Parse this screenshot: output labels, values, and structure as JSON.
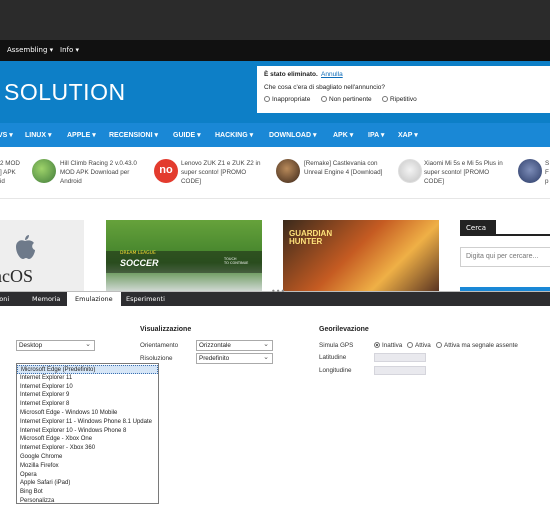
{
  "site_nav": {
    "items": [
      "Assembling ▾",
      "Info ▾"
    ]
  },
  "header": {
    "logo": "SOLUTION"
  },
  "notice": {
    "title": "È stato eliminato.",
    "undo": "Annulla",
    "question": "Che cosa c'era di sbagliato nell'annuncio?",
    "options": [
      "Inappropriate",
      "Non pertinente",
      "Ripetitivo"
    ]
  },
  "categories": [
    "VS ▾",
    "LINUX ▾",
    "APPLE ▾",
    "RECENSIONI ▾",
    "GUIDE ▾",
    "HACKING ▾",
    "DOWNLOAD ▾",
    "APK ▾",
    "IPA ▾",
    "XAP ▾"
  ],
  "ticker": [
    {
      "text": "2 MOD\n] APK\nid"
    },
    {
      "text": "Hill Climb Racing 2 v.0.43.0\nMOD APK Download per\nAndroid"
    },
    {
      "badge": "no",
      "text": "Lenovo ZUK Z1 e ZUK Z2 in\nsuper sconto! [PROMO\nCODE]"
    },
    {
      "text": "[Remake] Castlevania con\nUnreal Engine 4 [Download]"
    },
    {
      "text": "Xiaomi Mi 5s e Mi 5s Plus in\nsuper sconto! [PROMO\nCODE]"
    },
    {
      "text": "S\nF\np"
    }
  ],
  "featured": {
    "mac": "acOS",
    "soccer_brand": "DREAM LEAGUE",
    "soccer_title": "SOCCER",
    "soccer_cta": "TOUCH\nTO CONTINUE",
    "hunter_title": "GUARDIAN\nHUNTER"
  },
  "search": {
    "title": "Cerca",
    "placeholder": "Digita qui per cercare..."
  },
  "devtools": {
    "tabs": [
      "zioni",
      "Memoria",
      "Emulazione",
      "Esperimenti"
    ],
    "active_tab": "Emulazione",
    "mode": {
      "value": "Desktop"
    },
    "visualizzazione": {
      "section": "Visualizzazione",
      "orientamento_label": "Orientamento",
      "orientamento_value": "Orizzontale",
      "risoluzione_label": "Risoluzione",
      "risoluzione_value": "Predefinito"
    },
    "georilevazione": {
      "section": "Georilevazione",
      "gps_label": "Simula GPS",
      "gps_options": [
        "Inattiva",
        "Attiva",
        "Attiva ma segnale assente"
      ],
      "lat_label": "Latitudine",
      "lon_label": "Longitudine"
    },
    "user_agents": [
      "Microsoft Edge (Predefinito)",
      "Internet Explorer 11",
      "Internet Explorer 10",
      "Internet Explorer 9",
      "Internet Explorer 8",
      "Microsoft Edge - Windows 10 Mobile",
      "Internet Explorer 11 - Windows Phone 8.1 Update",
      "Internet Explorer 10 - Windows Phone 8",
      "Microsoft Edge - Xbox One",
      "Internet Explorer - Xbox 360",
      "Google Chrome",
      "Mozilla Firefox",
      "Opera",
      "Apple Safari (iPad)",
      "Bing Bot",
      "Personalizza"
    ]
  },
  "colors": {
    "header_blue": "#0d7fc7",
    "menu_blue": "#1a88d6",
    "devtools_dark": "#2d2d30"
  }
}
